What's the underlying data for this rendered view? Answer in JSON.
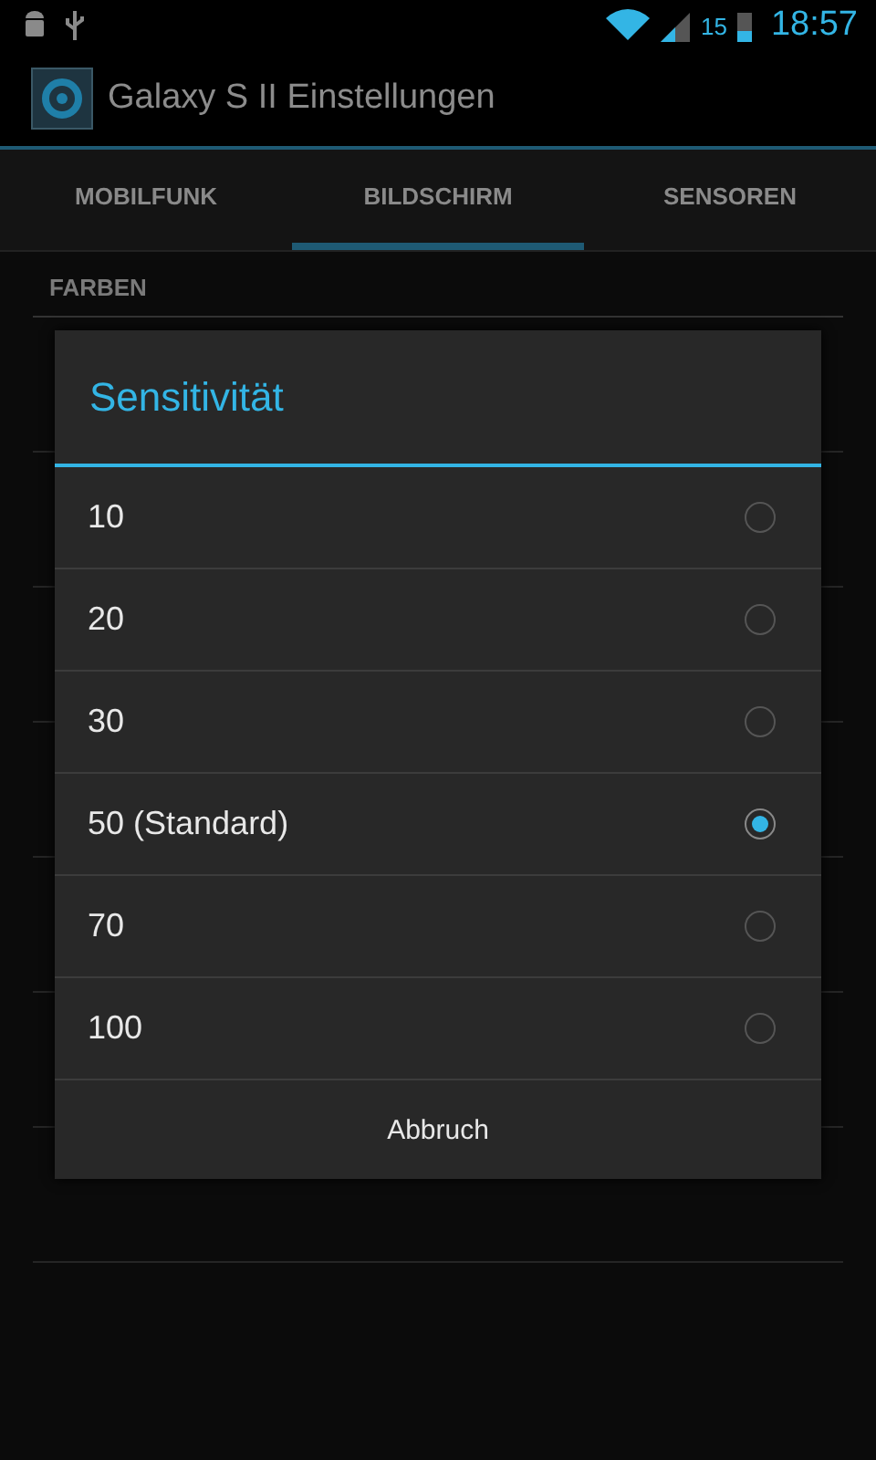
{
  "status_bar": {
    "battery_percent": "15",
    "time": "18:57"
  },
  "action_bar": {
    "title": "Galaxy S II Einstellungen"
  },
  "tabs": [
    {
      "label": "MOBILFUNK",
      "selected": false
    },
    {
      "label": "BILDSCHIRM",
      "selected": true
    },
    {
      "label": "SENSOREN",
      "selected": false
    }
  ],
  "section_header": "FARBEN",
  "dialog": {
    "title": "Sensitivität",
    "options": [
      {
        "label": "10",
        "selected": false
      },
      {
        "label": "20",
        "selected": false
      },
      {
        "label": "30",
        "selected": false
      },
      {
        "label": "50 (Standard)",
        "selected": true
      },
      {
        "label": "70",
        "selected": false
      },
      {
        "label": "100",
        "selected": false
      }
    ],
    "cancel_button": "Abbruch"
  }
}
